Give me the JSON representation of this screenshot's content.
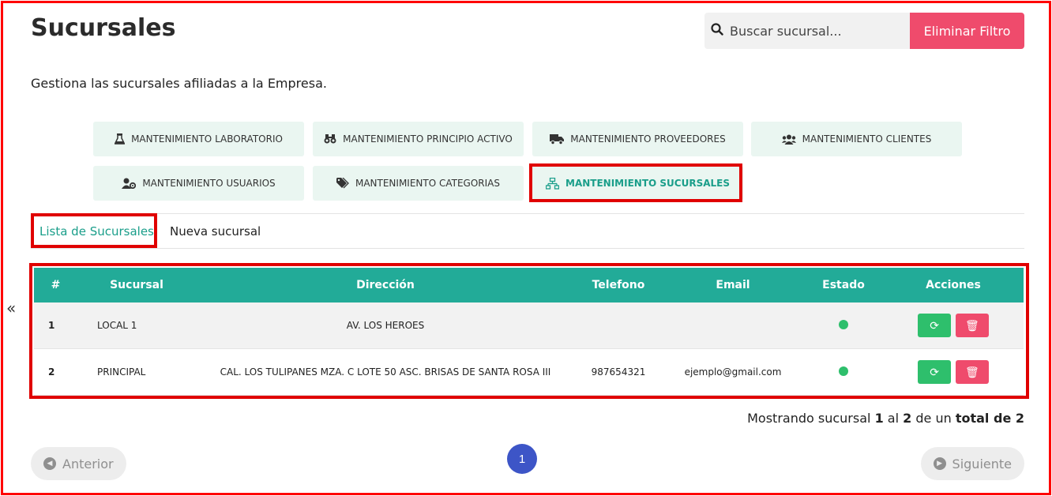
{
  "header": {
    "title": "Sucursales",
    "search_placeholder": "Buscar sucursal...",
    "clear_filter_label": "Eliminar Filtro"
  },
  "subtitle": "Gestiona las sucursales afiliadas a la Empresa.",
  "modules": [
    {
      "label": "MANTENIMIENTO LABORATORIO",
      "icon": "flask-icon"
    },
    {
      "label": "MANTENIMIENTO PRINCIPIO ACTIVO",
      "icon": "binoculars-icon"
    },
    {
      "label": "MANTENIMIENTO PROVEEDORES",
      "icon": "truck-icon"
    },
    {
      "label": "MANTENIMIENTO CLIENTES",
      "icon": "users-icon"
    },
    {
      "label": "MANTENIMIENTO USUARIOS",
      "icon": "user-gear-icon"
    },
    {
      "label": "MANTENIMIENTO CATEGORIAS",
      "icon": "tags-icon"
    },
    {
      "label": "MANTENIMIENTO SUCURSALES",
      "icon": "sitemap-icon",
      "active": true
    }
  ],
  "tabs": [
    {
      "label": "Lista de Sucursales",
      "active": true
    },
    {
      "label": "Nueva sucursal"
    }
  ],
  "sidebar_toggle": "«",
  "table": {
    "columns": [
      "#",
      "Sucursal",
      "Dirección",
      "Telefono",
      "Email",
      "Estado",
      "Acciones"
    ],
    "rows": [
      {
        "num": "1",
        "name": "LOCAL 1",
        "address": "AV. LOS HEROES",
        "phone": "",
        "email": "",
        "status": "active"
      },
      {
        "num": "2",
        "name": "PRINCIPAL",
        "address": "CAL. LOS TULIPANES MZA. C LOTE 50 ASC. BRISAS DE SANTA ROSA III",
        "phone": "987654321",
        "email": "ejemplo@gmail.com",
        "status": "active"
      }
    ]
  },
  "summary": {
    "prefix": "Mostrando sucursal",
    "from": "1",
    "mid": "al",
    "to": "2",
    "of": "de un",
    "total_label": "total de 2"
  },
  "pagination": {
    "prev": "Anterior",
    "page": "1",
    "next": "Siguiente"
  },
  "colors": {
    "accent": "#22ab98",
    "danger": "#ef4b6c",
    "success": "#2ebf6c",
    "page_active": "#3d55c7",
    "highlight": "#e00000"
  }
}
